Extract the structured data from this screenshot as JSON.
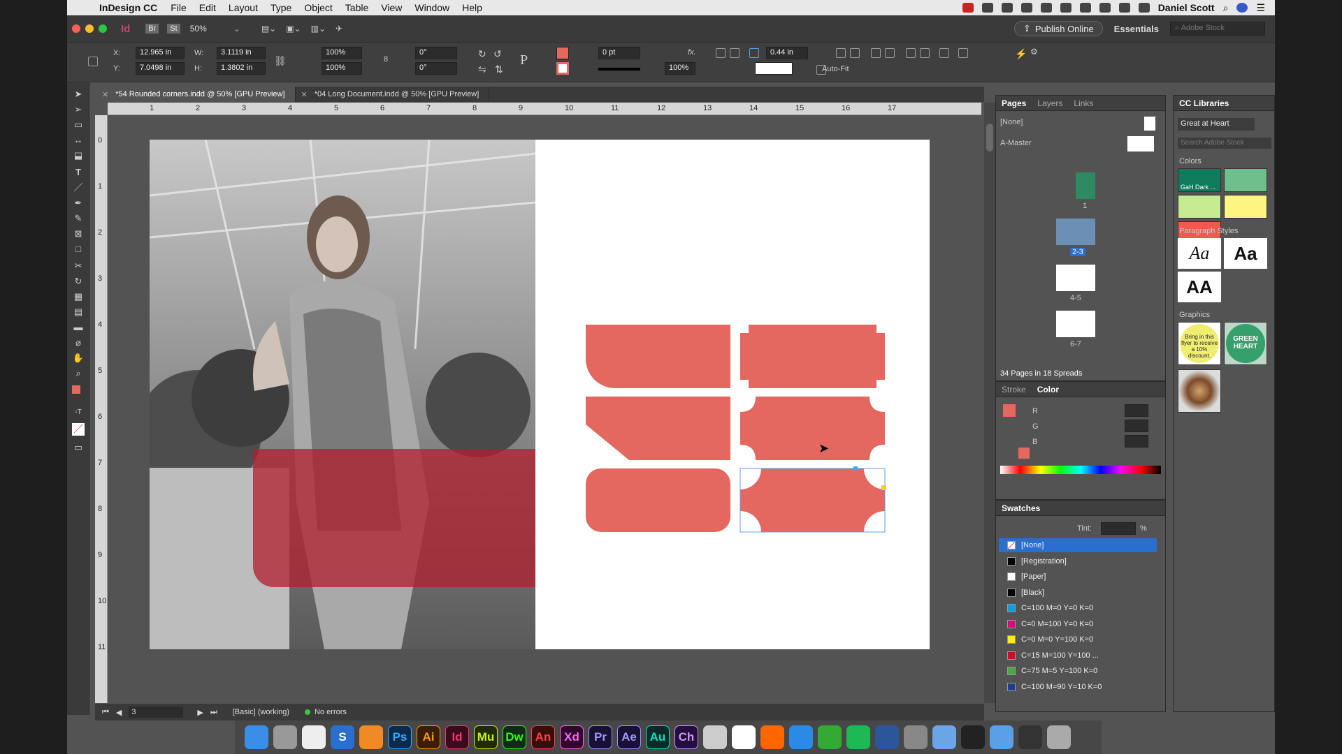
{
  "menubar": {
    "app": "InDesign CC",
    "items": [
      "File",
      "Edit",
      "Layout",
      "Type",
      "Object",
      "Table",
      "View",
      "Window",
      "Help"
    ],
    "user": "Daniel Scott"
  },
  "appbar": {
    "zoom": "50%",
    "publish": "Publish Online",
    "workspace": "Essentials",
    "search_placeholder": "Adobe Stock"
  },
  "control": {
    "x": "12.965 in",
    "y": "7.0498 in",
    "w": "3.1119 in",
    "h": "1.3802 in",
    "scale_x": "100%",
    "scale_y": "100%",
    "rotate": "0°",
    "shear": "0°",
    "stroke_weight": "0 pt",
    "opacity": "100%",
    "corner": "0.44 in",
    "autofit": "Auto-Fit"
  },
  "tabs": [
    {
      "label": "*54 Rounded corners.indd @ 50% [GPU Preview]"
    },
    {
      "label": "*04 Long Document.indd @ 50% [GPU Preview]"
    }
  ],
  "rulers": {
    "h": [
      "1",
      "2",
      "3",
      "4",
      "5",
      "6",
      "7",
      "8",
      "9",
      "10",
      "11",
      "12",
      "13",
      "14",
      "15",
      "16",
      "17"
    ],
    "v": [
      "0",
      "1",
      "2",
      "3",
      "4",
      "5",
      "6",
      "7",
      "8",
      "9",
      "10",
      "11"
    ]
  },
  "status": {
    "page": "3",
    "preflight_profile": "[Basic] (working)",
    "errors": "No errors"
  },
  "pages": {
    "tabs": [
      "Pages",
      "Layers",
      "Links"
    ],
    "none": "[None]",
    "master": "A-Master",
    "labels": [
      "1",
      "2-3",
      "4-5",
      "6-7"
    ],
    "summary": "34 Pages in 18 Spreads"
  },
  "color": {
    "tabs": [
      "Stroke",
      "Color"
    ],
    "channels": [
      "R",
      "G",
      "B"
    ],
    "fill": "#e4685f"
  },
  "swatches": {
    "title": "Swatches",
    "tint": "Tint:",
    "tint_unit": "%",
    "items": [
      {
        "name": "[None]",
        "color": "none"
      },
      {
        "name": "[Registration]",
        "color": "#000000"
      },
      {
        "name": "[Paper]",
        "color": "#ffffff"
      },
      {
        "name": "[Black]",
        "color": "#000000"
      },
      {
        "name": "C=100 M=0 Y=0 K=0",
        "color": "#00a0e3"
      },
      {
        "name": "C=0 M=100 Y=0 K=0",
        "color": "#e2007a"
      },
      {
        "name": "C=0 M=0 Y=100 K=0",
        "color": "#ffed00"
      },
      {
        "name": "C=15 M=100 Y=100 ...",
        "color": "#c8102e"
      },
      {
        "name": "C=75 M=5 Y=100 K=0",
        "color": "#4aa842"
      },
      {
        "name": "C=100 M=90 Y=10 K=0",
        "color": "#213d8f"
      }
    ]
  },
  "cclib": {
    "title": "CC Libraries",
    "library": "Great at Heart",
    "search_placeholder": "Search Adobe Stock",
    "colors_label": "Colors",
    "colors": [
      {
        "hex": "#0f7a5c",
        "name": "GaH Dark ..."
      },
      {
        "hex": "#6ebf8b"
      },
      {
        "hex": "#c6ea92"
      },
      {
        "hex": "#fdf57f"
      },
      {
        "hex": "#ef5a4f"
      }
    ],
    "para_label": "Paragraph Styles",
    "para": [
      "Aa",
      "Aa",
      "Aa",
      "AA"
    ],
    "graphics_label": "Graphics",
    "graphic_text": "Bring in this flyer to receive a 10% discount.",
    "green_heart": "GREEN HEART"
  },
  "dock": [
    "Ps",
    "Ai",
    "Id",
    "Mu",
    "Dw",
    "An",
    "Xd",
    "Pr",
    "Ae",
    "Au",
    "Ch"
  ]
}
